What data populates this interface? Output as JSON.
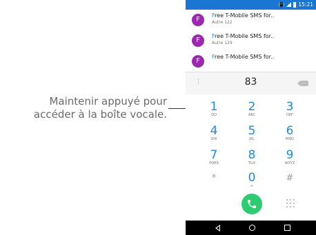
{
  "callout": {
    "line1": "Maintenir appuyé pour",
    "line2": "accéder à la boîte vocale."
  },
  "status_bar": {
    "time": "15:21",
    "icons": [
      "vibrate-icon",
      "signal-icon",
      "battery-icon"
    ]
  },
  "contacts": [
    {
      "initial": "F",
      "name_highlight": "F",
      "name_rest": "ree T-Mobile SMS for..",
      "sub": "Autre 122"
    },
    {
      "initial": "F",
      "name_highlight": "F",
      "name_rest": "ree T-Mobile SMS for..",
      "sub": "Autre 129"
    },
    {
      "initial": "F",
      "name_highlight": "F",
      "name_rest": "ree T-Mobile SMS for..",
      "sub": ""
    }
  ],
  "dialer": {
    "entered_number": "83",
    "overflow_icon": "overflow-menu-icon",
    "backspace_icon": "backspace-icon",
    "keys": [
      {
        "num": "1",
        "letters": "QO"
      },
      {
        "num": "2",
        "letters": "ABC"
      },
      {
        "num": "3",
        "letters": "DEF"
      },
      {
        "num": "4",
        "letters": "GHI"
      },
      {
        "num": "5",
        "letters": "JKL"
      },
      {
        "num": "6",
        "letters": "MNO"
      },
      {
        "num": "7",
        "letters": "PQRS"
      },
      {
        "num": "8",
        "letters": "TUV"
      },
      {
        "num": "9",
        "letters": "WXYZ"
      },
      {
        "num": "*",
        "letters": ""
      },
      {
        "num": "0",
        "letters": "+"
      },
      {
        "num": "#",
        "letters": ""
      }
    ],
    "call_icon": "phone-call-icon",
    "dialpad_toggle_icon": "dialpad-grid-icon"
  },
  "colors": {
    "status_bar": "#1976d2",
    "accent": "#1e88e5",
    "avatar": "#9c27b0",
    "call_button": "#2ecc71"
  },
  "nav": [
    "back-icon",
    "home-icon",
    "recents-icon"
  ]
}
